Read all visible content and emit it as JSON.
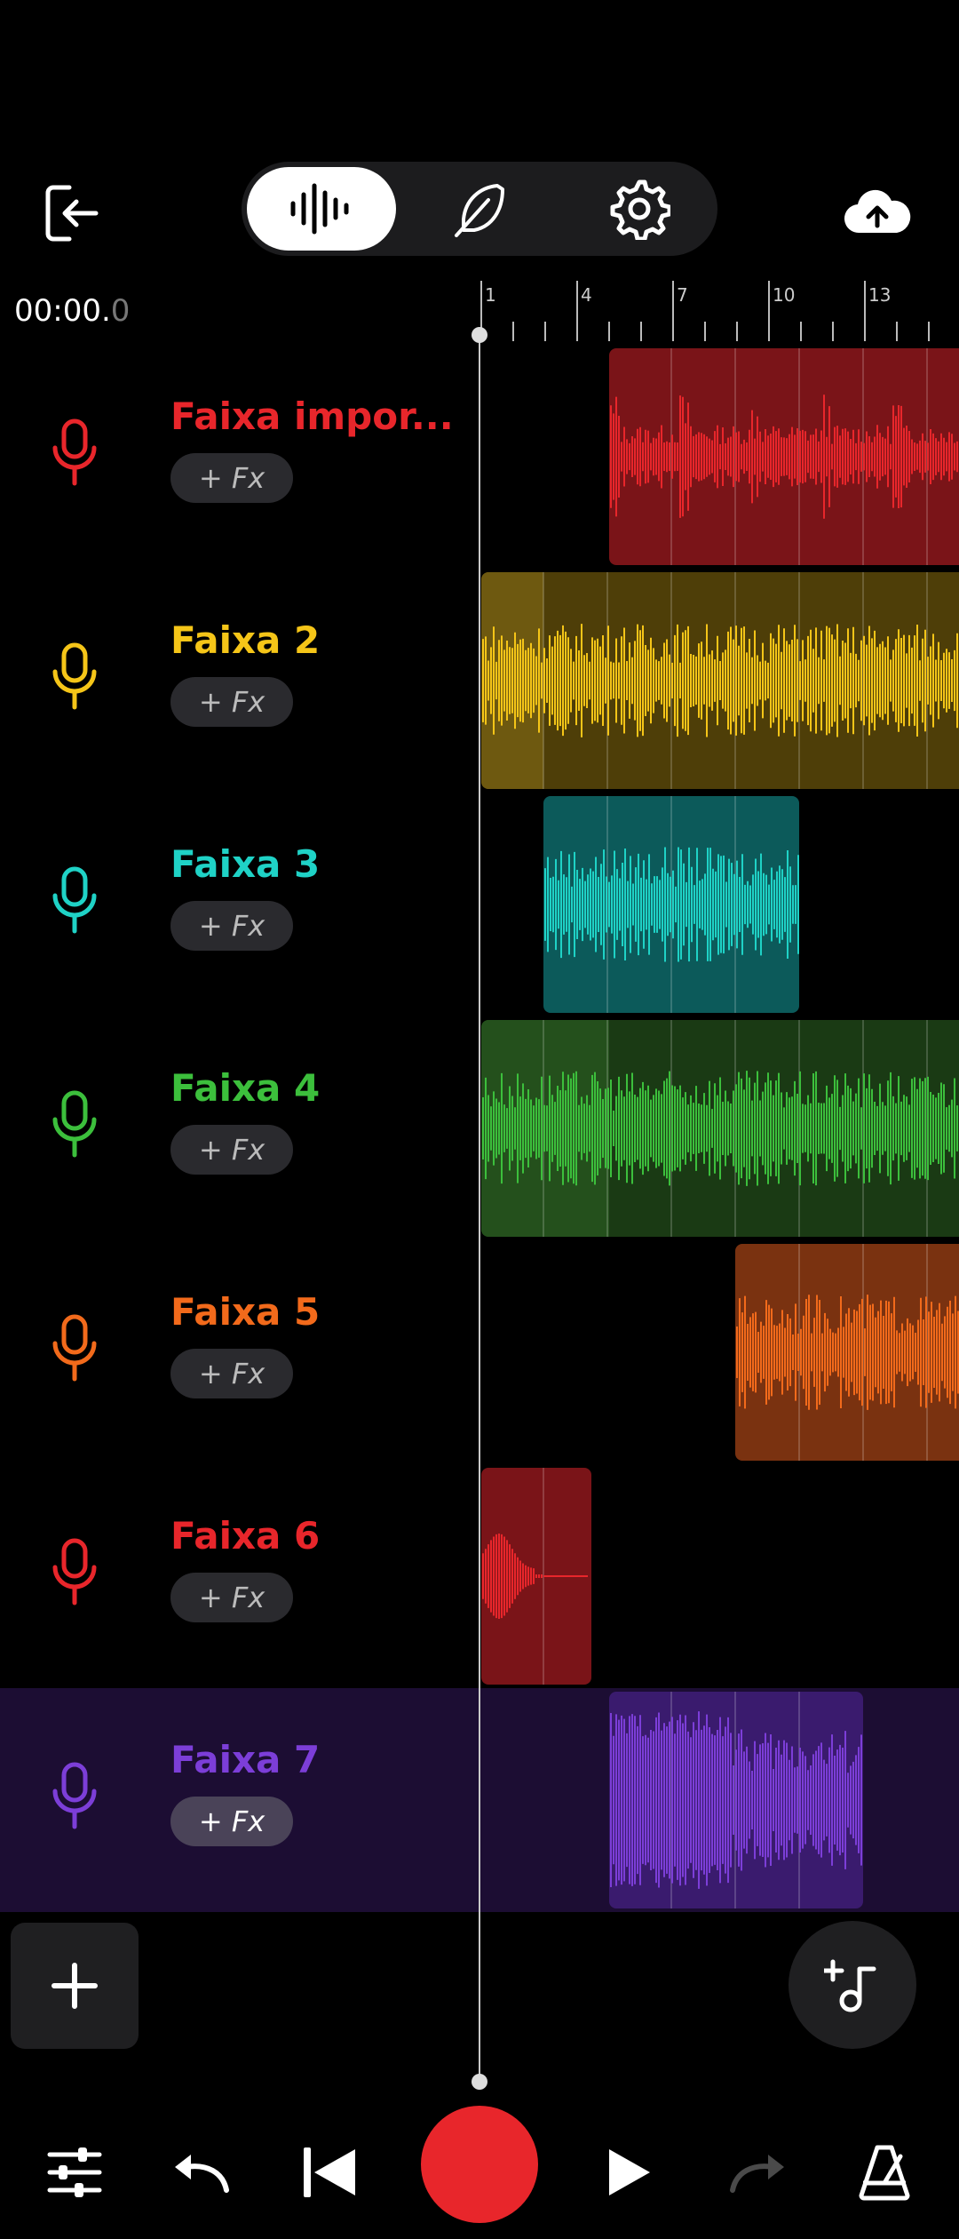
{
  "header": {
    "icons": [
      "exit-icon",
      "waveform-icon",
      "feather-icon",
      "gear-icon",
      "cloud-upload-icon"
    ],
    "active_mode": "waveform"
  },
  "timeline": {
    "time_main": "00:00.",
    "time_frac": "0",
    "ruler_labels": [
      "1",
      "4",
      "7",
      "10",
      "13"
    ]
  },
  "tracks": [
    {
      "name": "Faixa impor...",
      "fx": "+ Fx",
      "color": "#e8262b"
    },
    {
      "name": "Faixa 2",
      "fx": "+ Fx",
      "color": "#f5c518"
    },
    {
      "name": "Faixa 3",
      "fx": "+ Fx",
      "color": "#1fd2c6"
    },
    {
      "name": "Faixa 4",
      "fx": "+ Fx",
      "color": "#3cbf3c"
    },
    {
      "name": "Faixa 5",
      "fx": "+ Fx",
      "color": "#f26a1b"
    },
    {
      "name": "Faixa 6",
      "fx": "+ Fx",
      "color": "#e8262b"
    },
    {
      "name": "Faixa 7",
      "fx": "+ Fx",
      "color": "#7c3ed8"
    }
  ],
  "selected_track": 6,
  "bottom": {
    "icons": [
      "mixer-icon",
      "undo-icon",
      "skip-back-icon",
      "record-button",
      "play-icon",
      "redo-icon",
      "metronome-icon"
    ],
    "add_track": "add-track-icon",
    "add_instrument": "add-note-icon"
  }
}
